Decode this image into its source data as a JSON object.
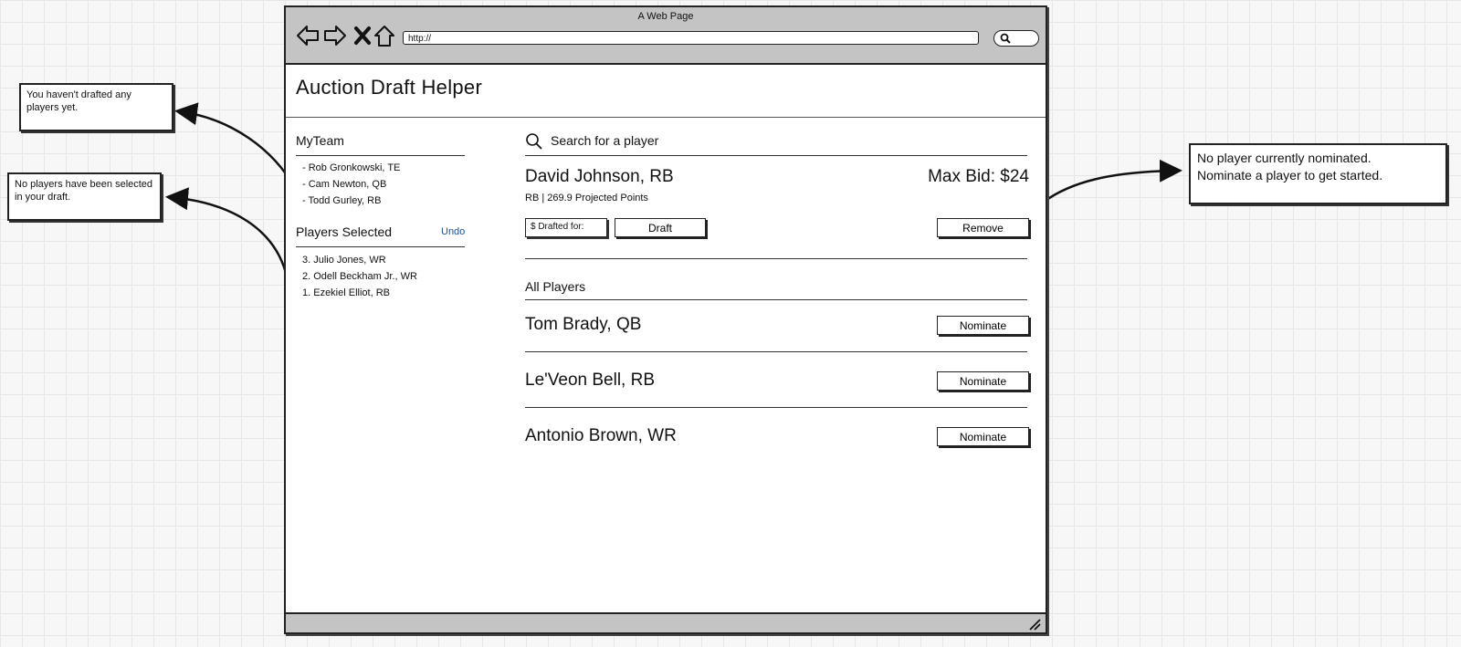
{
  "annotations": {
    "team_note": "You haven't drafted any players yet.",
    "selected_note": "No players have been selected in your draft.",
    "nominate_note_line1": "No player currently nominated.",
    "nominate_note_line2": "Nominate a player to get started."
  },
  "browser": {
    "window_title": "A Web Page",
    "url": "http://"
  },
  "app": {
    "title": "Auction Draft Helper"
  },
  "sidebar": {
    "my_team_title": "MyTeam",
    "team": [
      "- Rob Gronkowski, TE",
      "- Cam Newton, QB",
      "- Todd Gurley, RB"
    ],
    "players_selected_title": "Players Selected",
    "undo_label": "Undo",
    "selected": [
      "3. Julio Jones, WR",
      "2. Odell Beckham Jr., WR",
      "1. Ezekiel Elliot, RB"
    ]
  },
  "main": {
    "search_placeholder": "Search for a player",
    "nominated": {
      "name": "David Johnson, RB",
      "stats": "RB | 269.9 Projected Points",
      "max_bid": "Max Bid: $24",
      "drafted_for_placeholder": "$ Drafted for:",
      "draft_label": "Draft",
      "remove_label": "Remove"
    },
    "all_players_title": "All Players",
    "players": [
      {
        "name": "Tom Brady, QB",
        "action": "Nominate"
      },
      {
        "name": "Le'Veon Bell, RB",
        "action": "Nominate"
      },
      {
        "name": "Antonio Brown, WR",
        "action": "Nominate"
      }
    ]
  },
  "icons": {
    "back": "back-arrow-icon",
    "forward": "forward-arrow-icon",
    "stop": "close-icon",
    "home": "home-icon",
    "search": "search-icon"
  }
}
